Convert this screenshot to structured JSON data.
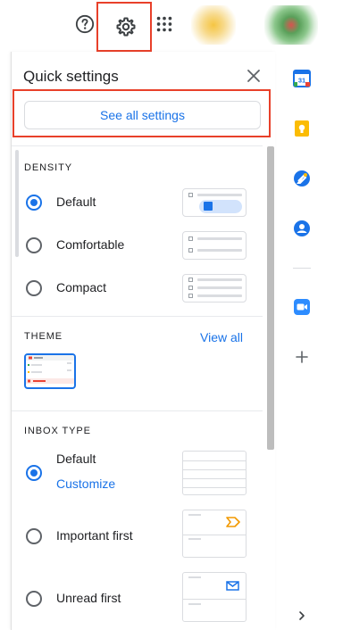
{
  "header": {
    "help_icon": "help-circle-icon",
    "settings_icon": "gear-icon",
    "apps_icon": "apps-grid-icon"
  },
  "quick_settings": {
    "title": "Quick settings",
    "see_all_label": "See all settings",
    "density": {
      "title": "DENSITY",
      "options": [
        "Default",
        "Comfortable",
        "Compact"
      ],
      "selected": "Default"
    },
    "theme": {
      "title": "THEME",
      "view_all_label": "View all"
    },
    "inbox_type": {
      "title": "INBOX TYPE",
      "options": [
        "Default",
        "Important first",
        "Unread first"
      ],
      "selected": "Default",
      "customize_label": "Customize"
    }
  },
  "side_rail": {
    "apps": [
      "calendar-icon",
      "keep-icon",
      "tasks-icon",
      "contacts-icon",
      "zoom-icon"
    ],
    "add_icon": "plus-icon",
    "expand_icon": "chevron-right-icon"
  },
  "colors": {
    "accent": "#1a73e8",
    "highlight_border": "#e8402a"
  }
}
